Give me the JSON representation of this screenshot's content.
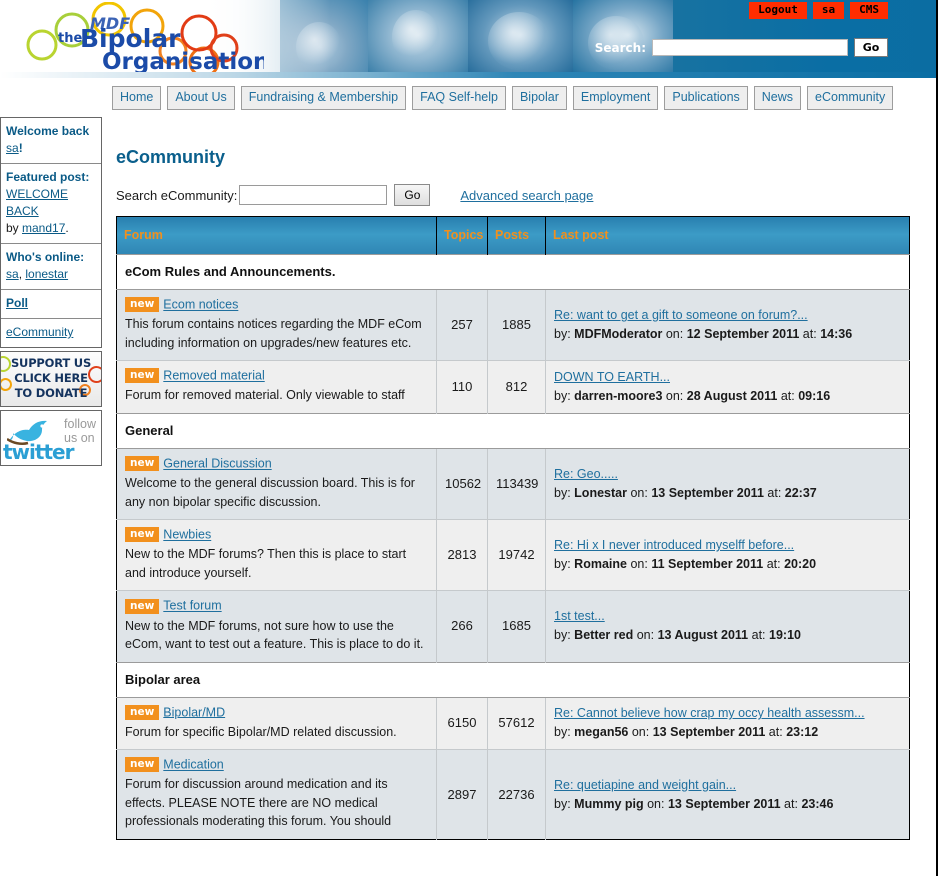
{
  "site": {
    "logo_small": "MDF",
    "logo_the": "the",
    "logo_line1": "Bipolar",
    "logo_line2": "Organisation"
  },
  "topbar": {
    "buttons": [
      {
        "label": "Logout",
        "name": "logout-button"
      },
      {
        "label": "sa",
        "name": "username-button"
      },
      {
        "label": "CMS",
        "name": "cms-button"
      }
    ],
    "search_label": "Search:",
    "search_value": "",
    "search_placeholder": "",
    "go_label": "Go"
  },
  "nav": {
    "items": [
      {
        "label": "Home",
        "name": "nav-home"
      },
      {
        "label": "About Us",
        "name": "nav-about-us"
      },
      {
        "label": "Fundraising & Membership",
        "name": "nav-fundraising-membership"
      },
      {
        "label": "FAQ Self-help",
        "name": "nav-faq-self-help"
      },
      {
        "label": "Bipolar",
        "name": "nav-bipolar"
      },
      {
        "label": "Employment",
        "name": "nav-employment"
      },
      {
        "label": "Publications",
        "name": "nav-publications"
      },
      {
        "label": "News",
        "name": "nav-news"
      },
      {
        "label": "eCommunity",
        "name": "nav-ecommunity"
      }
    ]
  },
  "sidebar": {
    "welcome_prefix": "Welcome back ",
    "welcome_user": "sa",
    "welcome_suffix": "!",
    "featured_label": "Featured post:",
    "featured_post": "WELCOME BACK",
    "featured_by": "by ",
    "featured_author": "mand17",
    "featured_dot": ".",
    "online_label": "Who's online:",
    "online_users": [
      "sa",
      "lonestar"
    ],
    "online_sep": ", ",
    "poll_label": "Poll",
    "ecommunity_label": "eCommunity",
    "donate_line1": "SUPPORT US",
    "donate_line2": "CLICK HERE",
    "donate_line3": "TO DONATE",
    "twitter_line1": "follow",
    "twitter_line2": "us on",
    "twitter_word": "twitter"
  },
  "main": {
    "title": "eCommunity",
    "search_label": "Search eCommunity:",
    "search_value": "",
    "search_placeholder": "",
    "go_label": "Go",
    "advanced_link": "Advanced search page"
  },
  "table": {
    "headers": {
      "forum": "Forum",
      "topics": "Topics",
      "posts": "Posts",
      "last_post": "Last post"
    },
    "sections": [
      {
        "title": "eCom Rules and Announcements.",
        "rows": [
          {
            "badge": "new",
            "name": "Ecom notices",
            "desc": "This forum contains notices regarding the MDF eCom including information on upgrades/new features etc.",
            "topics": "257",
            "posts": "1885",
            "last_title": "Re: want to get a gift to someone on forum?...",
            "last_by_label": "by:",
            "last_by": "MDFModerator",
            "last_on_label": "on:",
            "last_date": "12 September 2011",
            "last_at_label": "at:",
            "last_time": "14:36"
          },
          {
            "badge": "new",
            "name": "Removed material",
            "desc": "Forum for removed material. Only viewable to staff",
            "topics": "110",
            "posts": "812",
            "last_title": "DOWN TO EARTH...",
            "last_by_label": "by:",
            "last_by": "darren-moore3",
            "last_on_label": "on:",
            "last_date": "28 August 2011",
            "last_at_label": "at:",
            "last_time": "09:16"
          }
        ]
      },
      {
        "title": "General",
        "rows": [
          {
            "badge": "new",
            "name": "General Discussion",
            "desc": "Welcome to the general discussion board. This is for any non bipolar specific discussion.",
            "topics": "10562",
            "posts": "113439",
            "last_title": "Re: Geo.....",
            "last_by_label": "by:",
            "last_by": "Lonestar",
            "last_on_label": "on:",
            "last_date": "13 September 2011",
            "last_at_label": "at:",
            "last_time": "22:37"
          },
          {
            "badge": "new",
            "name": "Newbies",
            "desc": "New to the MDF forums? Then this is place to start and introduce yourself.",
            "topics": "2813",
            "posts": "19742",
            "last_title": "Re: Hi x I never introduced myselff before...",
            "last_by_label": "by:",
            "last_by": "Romaine",
            "last_on_label": "on:",
            "last_date": "11 September 2011",
            "last_at_label": "at:",
            "last_time": "20:20"
          },
          {
            "badge": "new",
            "name": "Test forum",
            "desc": "New to the MDF forums, not sure how to use the eCom, want to test out a feature. This is place to do it.",
            "topics": "266",
            "posts": "1685",
            "last_title": "1st test...",
            "last_by_label": "by:",
            "last_by": "Better red",
            "last_on_label": "on:",
            "last_date": "13 August 2011",
            "last_at_label": "at:",
            "last_time": "19:10"
          }
        ]
      },
      {
        "title": "Bipolar area",
        "rows": [
          {
            "badge": "new",
            "name": "Bipolar/MD",
            "desc": "Forum for specific Bipolar/MD related discussion.",
            "topics": "6150",
            "posts": "57612",
            "last_title": "Re: Cannot believe how crap my occy health assessm...",
            "last_by_label": "by:",
            "last_by": "megan56",
            "last_on_label": "on:",
            "last_date": "13 September 2011",
            "last_at_label": "at:",
            "last_time": "23:12"
          },
          {
            "badge": "new",
            "name": "Medication",
            "desc": "Forum for discussion around medication and its effects. PLEASE NOTE there are NO medical professionals moderating this forum. You should",
            "topics": "2897",
            "posts": "22736",
            "last_title": "Re: quetiapine and weight gain...",
            "last_by_label": "by:",
            "last_by": "Mummy pig",
            "last_on_label": "on:",
            "last_date": "13 September 2011",
            "last_at_label": "at:",
            "last_time": "23:46"
          }
        ]
      }
    ]
  },
  "colors": {
    "brand_blue": "#0a6ea4",
    "link_blue": "#1f6f9e",
    "accent_orange": "#f2901d",
    "header_orange": "#f0901e",
    "button_red": "#ff2d00",
    "row_alt": "#dfe4e8",
    "row_norm": "#efefef"
  }
}
